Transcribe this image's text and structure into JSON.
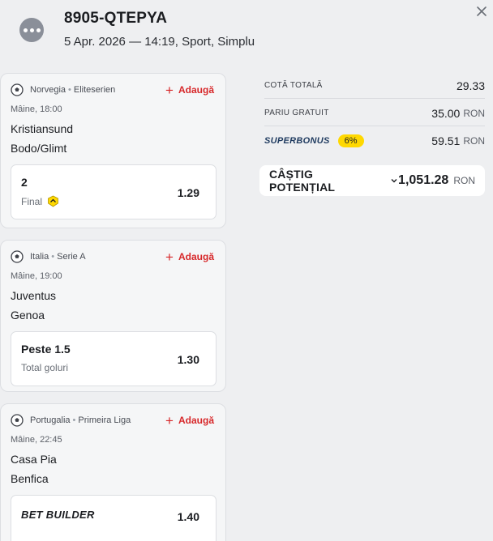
{
  "header": {
    "ticket_id": "8905-QTEPYA",
    "meta": "5 Apr. 2026 — 14:19, Sport, Simplu",
    "menu_icon": "more-dots-icon",
    "close_icon": "close-icon"
  },
  "bets": [
    {
      "country": "Norvegia",
      "league": "Eliteserien",
      "add_label": "Adaugă",
      "kickoff": "Mâine, 18:00",
      "home": "Kristiansund",
      "away": "Bodo/Glimt",
      "pick": "2",
      "market": "Final",
      "odd": "1.29"
    },
    {
      "country": "Italia",
      "league": "Serie A",
      "add_label": "Adaugă",
      "kickoff": "Mâine, 19:00",
      "home": "Juventus",
      "away": "Genoa",
      "pick": "Peste 1.5",
      "market": "Total goluri",
      "odd": "1.30"
    },
    {
      "country": "Portugalia",
      "league": "Primeira Liga",
      "add_label": "Adaugă",
      "kickoff": "Mâine, 22:45",
      "home": "Casa Pia",
      "away": "Benfica",
      "pick": "BET BUILDER",
      "odd": "1.40"
    }
  ],
  "summary": {
    "total_odds_label": "COTĂ TOTALĂ",
    "total_odds": "29.33",
    "free_bet_label": "PARIU GRATUIT",
    "free_bet": "35.00",
    "superbonus_label": "SUPERBONUS",
    "superbonus_pct": "6%",
    "superbonus_value": "59.51",
    "currency": "RON",
    "potential_label": "CÂȘTIG POTENȚIAL",
    "potential_value": "1,051.28"
  },
  "colors": {
    "accent_red": "#d7282a",
    "bonus_yellow": "#ffd800",
    "background": "#eeeff1"
  }
}
